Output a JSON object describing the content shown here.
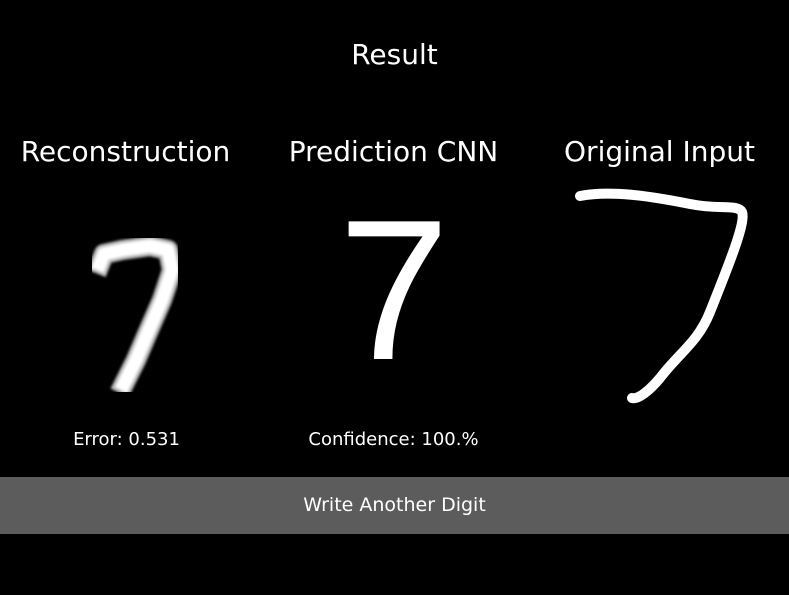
{
  "title": "Result",
  "columns": {
    "reconstruction": {
      "heading": "Reconstruction",
      "stat_label": "Error: 0.531"
    },
    "prediction": {
      "heading": "Prediction CNN",
      "digit": "7",
      "stat_label": "Confidence: 100.%"
    },
    "original": {
      "heading": "Original Input"
    }
  },
  "action": {
    "label": "Write Another Digit"
  },
  "colors": {
    "background": "#000000",
    "foreground": "#ffffff",
    "button_bg": "#5c5c5c"
  }
}
